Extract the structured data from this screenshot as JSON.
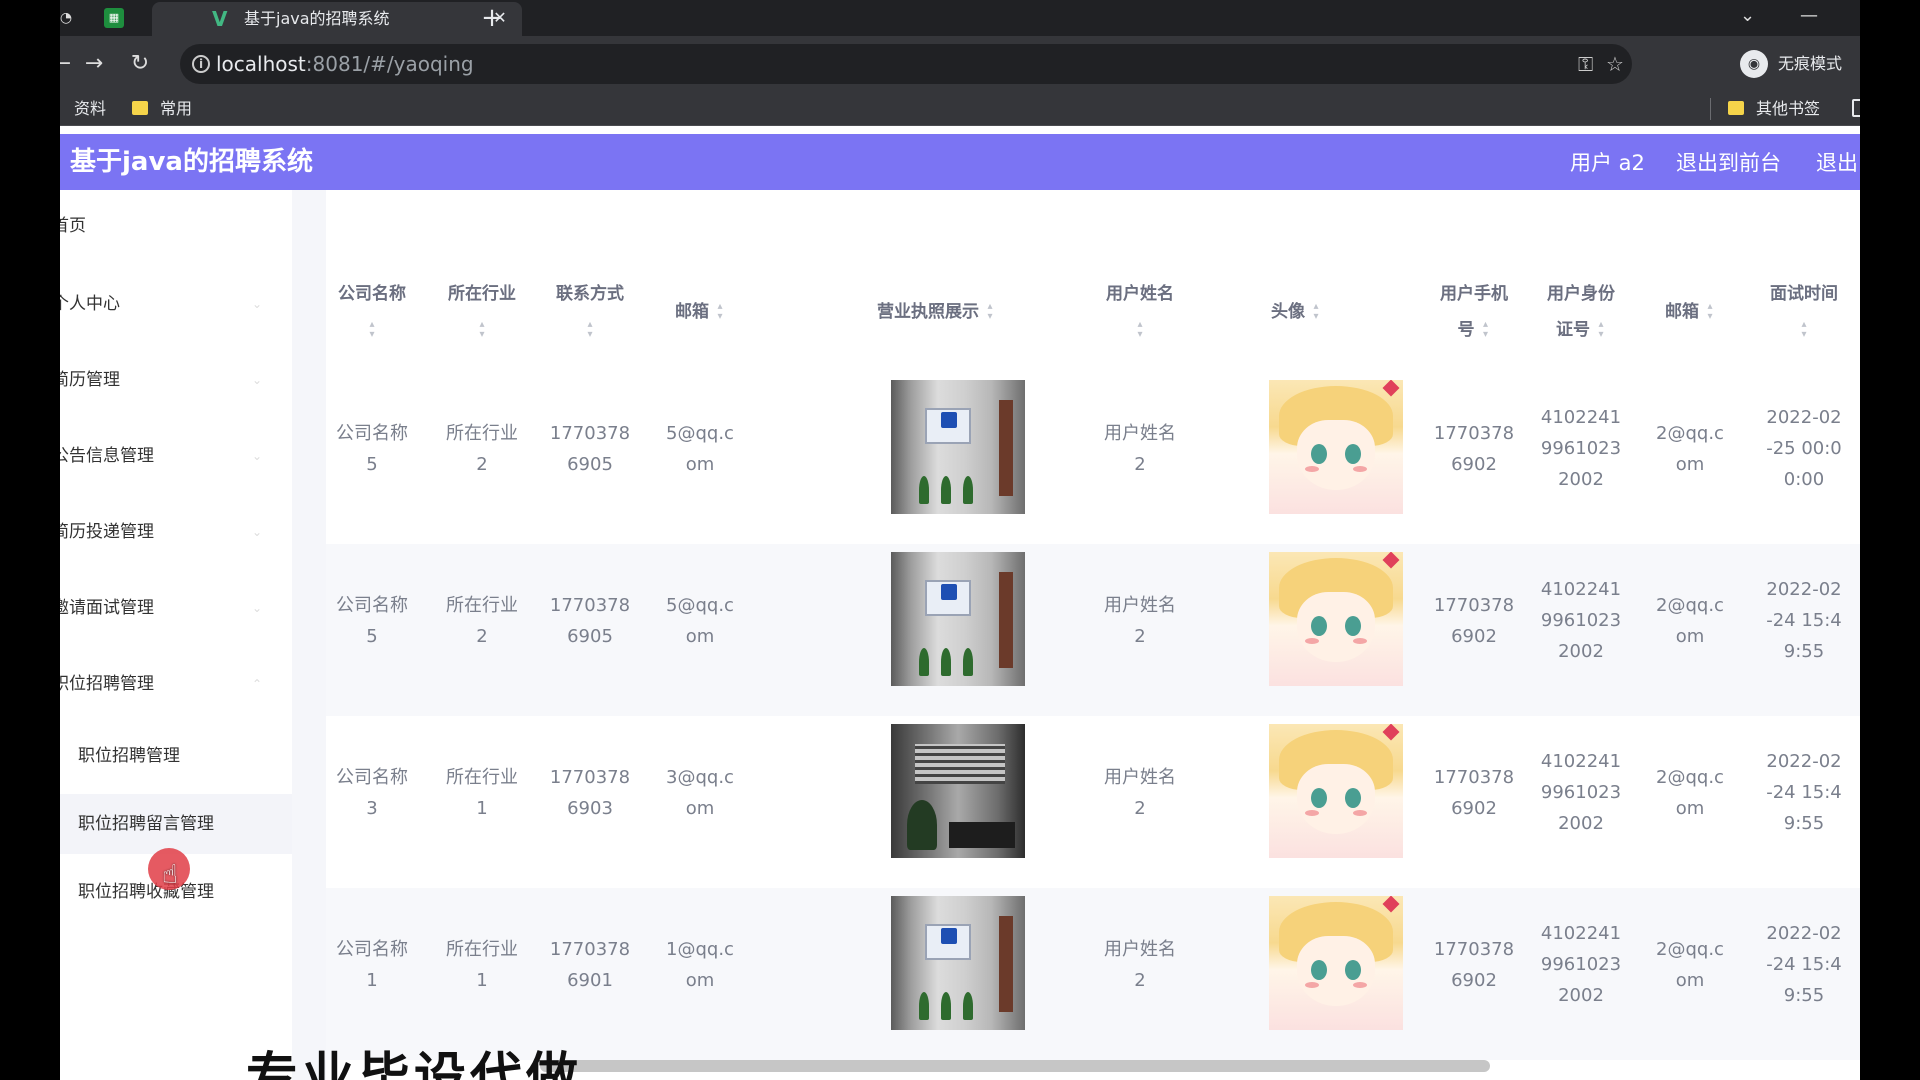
{
  "browser": {
    "tab_title": "基于java的招聘系统",
    "tab_favicon": "V",
    "url_host": "localhost",
    "url_path": ":8081/#/yaoqing",
    "incognito_label": "无痕模式",
    "bookmarks": [
      "资料",
      "常用"
    ],
    "other_bookmarks": "其他书签"
  },
  "app": {
    "title": "基于java的招聘系统",
    "user_label": "用户 a2",
    "back_label": "退出到前台",
    "logout_label": "退出",
    "header_color": "#7b74f3"
  },
  "sidebar": {
    "items": [
      "首页",
      "个人中心",
      "简历管理",
      "公告信息管理",
      "简历投递管理",
      "邀请面试管理",
      "职位招聘管理"
    ],
    "subitems": [
      "职位招聘管理",
      "职位招聘留言管理",
      "职位招聘收藏管理"
    ]
  },
  "table": {
    "headers": {
      "company": [
        "公司名称"
      ],
      "industry": [
        "所在行业"
      ],
      "contact": [
        "联系方式"
      ],
      "email": [
        "邮箱"
      ],
      "license": [
        "营业执照展示"
      ],
      "username": [
        "用户姓名"
      ],
      "avatar": [
        "头像"
      ],
      "phone": [
        "用户手机",
        "号"
      ],
      "idcard": [
        "用户身份",
        "证号"
      ],
      "user_email": [
        "邮箱"
      ],
      "interview_time": [
        "面试时间"
      ]
    },
    "rows": [
      {
        "company": [
          "公司名称",
          "5"
        ],
        "industry": [
          "所在行业",
          "2"
        ],
        "contact": [
          "1770378",
          "6905"
        ],
        "email": [
          "5@qq.c",
          "om"
        ],
        "username": [
          "用户姓名",
          "2"
        ],
        "phone": [
          "1770378",
          "6902"
        ],
        "idcard": [
          "4102241",
          "9961023",
          "2002"
        ],
        "user_email": [
          "2@qq.c",
          "om"
        ],
        "time": [
          "2022-02",
          "-25 00:0",
          "0:00"
        ]
      },
      {
        "company": [
          "公司名称",
          "5"
        ],
        "industry": [
          "所在行业",
          "2"
        ],
        "contact": [
          "1770378",
          "6905"
        ],
        "email": [
          "5@qq.c",
          "om"
        ],
        "username": [
          "用户姓名",
          "2"
        ],
        "phone": [
          "1770378",
          "6902"
        ],
        "idcard": [
          "4102241",
          "9961023",
          "2002"
        ],
        "user_email": [
          "2@qq.c",
          "om"
        ],
        "time": [
          "2022-02",
          "-24 15:4",
          "9:55"
        ]
      },
      {
        "company": [
          "公司名称",
          "3"
        ],
        "industry": [
          "所在行业",
          "1"
        ],
        "contact": [
          "1770378",
          "6903"
        ],
        "email": [
          "3@qq.c",
          "om"
        ],
        "username": [
          "用户姓名",
          "2"
        ],
        "phone": [
          "1770378",
          "6902"
        ],
        "idcard": [
          "4102241",
          "9961023",
          "2002"
        ],
        "user_email": [
          "2@qq.c",
          "om"
        ],
        "time": [
          "2022-02",
          "-24 15:4",
          "9:55"
        ]
      },
      {
        "company": [
          "公司名称",
          "1"
        ],
        "industry": [
          "所在行业",
          "1"
        ],
        "contact": [
          "1770378",
          "6901"
        ],
        "email": [
          "1@qq.c",
          "om"
        ],
        "username": [
          "用户姓名",
          "2"
        ],
        "phone": [
          "1770378",
          "6902"
        ],
        "idcard": [
          "4102241",
          "9961023",
          "2002"
        ],
        "user_email": [
          "2@qq.c",
          "om"
        ],
        "time": [
          "2022-02",
          "-24 15:4",
          "9:55"
        ]
      }
    ]
  },
  "overlay_caption": "专业毕设代做"
}
